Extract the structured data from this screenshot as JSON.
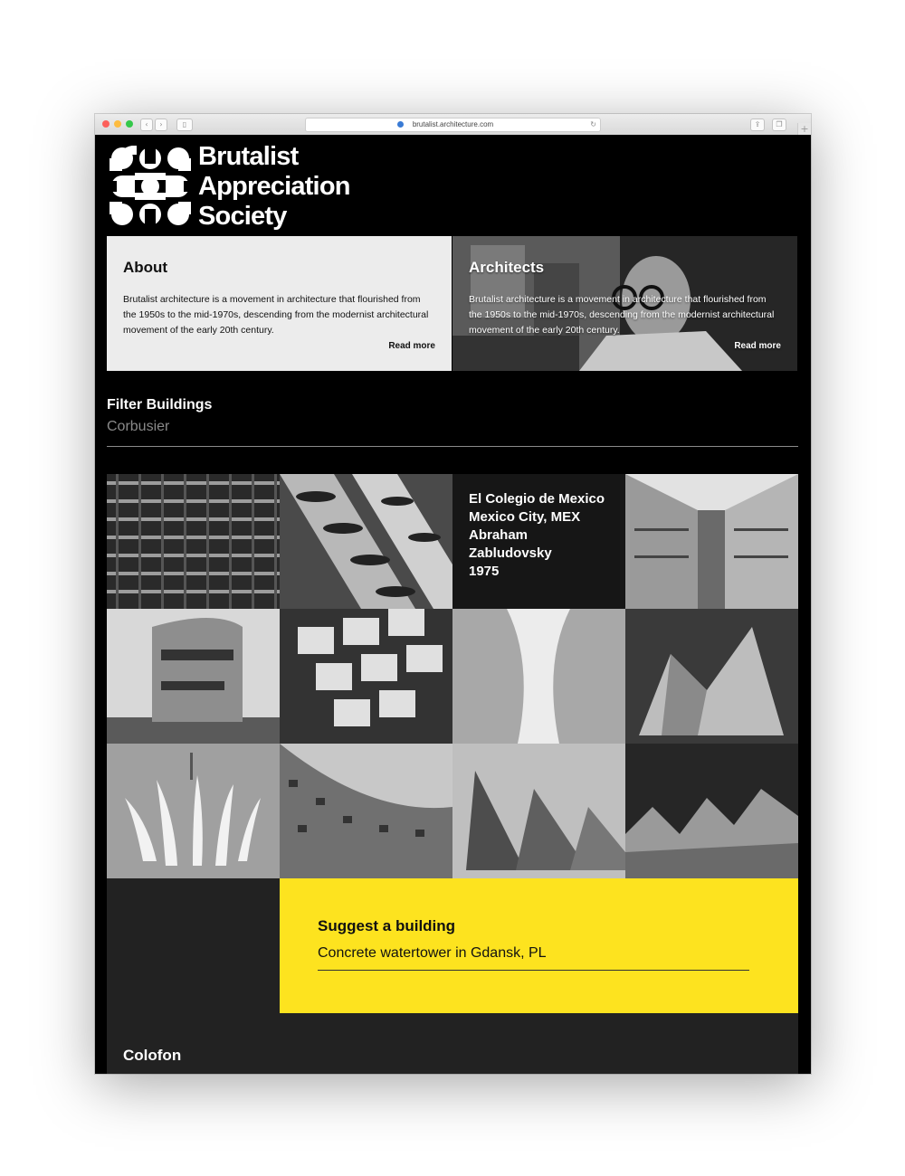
{
  "browser": {
    "url": "brutalist.architecture.com",
    "traffic_light_colors": [
      "#fc605b",
      "#fdbc40",
      "#34c84a"
    ]
  },
  "site": {
    "logo_lines": [
      "Brutalist",
      "Appreciation",
      "Society"
    ]
  },
  "cards": {
    "about": {
      "title": "About",
      "text": "Brutalist architecture is a movement in architecture that flourished from the 1950s to the mid-1970s, descending from the modernist architectural movement of the early 20th century.",
      "link": "Read more"
    },
    "architects": {
      "title": "Architects",
      "text": "Brutalist architecture is a movement in architecture that flourished from the 1950s to the mid-1970s, descending from the modernist architectural movement of the early 20th century.",
      "link": "Read more"
    }
  },
  "filter": {
    "title": "Filter Buildings",
    "value": "Corbusier"
  },
  "buildings": {
    "featured": {
      "name": "El Colegio de Mexico",
      "location": "Mexico City, MEX",
      "architect": "Abraham Zabludovsky",
      "year": "1975"
    }
  },
  "suggest": {
    "title": "Suggest a building",
    "value": "Concrete watertower in Gdansk, PL"
  },
  "footer": {
    "title": "Colofon"
  },
  "colors": {
    "accent_yellow": "#fde31f",
    "page_background": "#000000",
    "footer_background": "#222222"
  }
}
